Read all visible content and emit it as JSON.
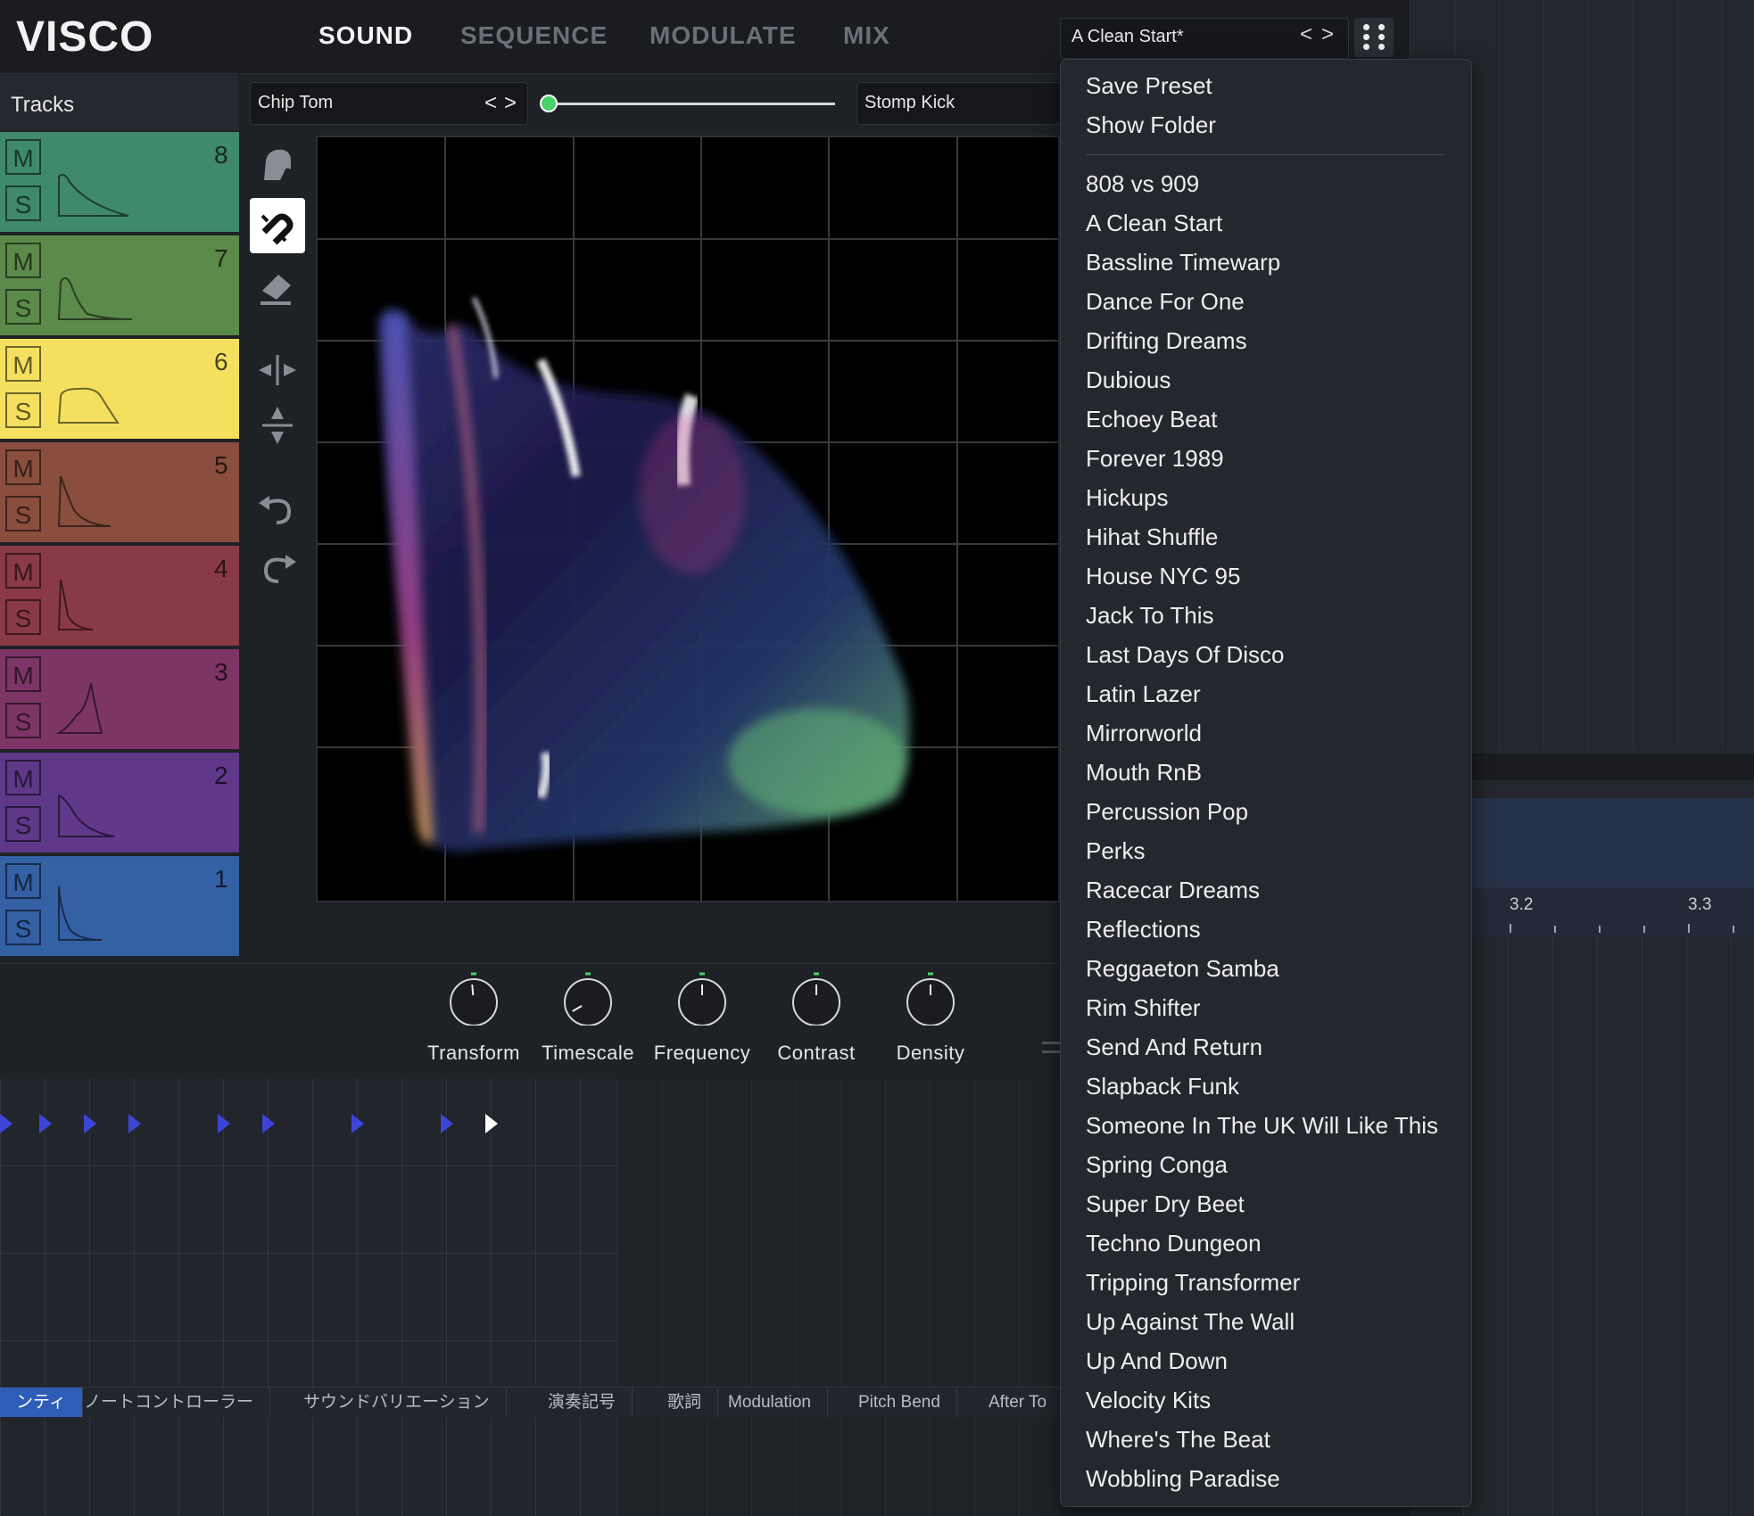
{
  "app": {
    "logo": "VISCO",
    "nav": [
      {
        "label": "SOUND",
        "active": true
      },
      {
        "label": "SEQUENCE",
        "active": false
      },
      {
        "label": "MODULATE",
        "active": false
      },
      {
        "label": "MIX",
        "active": false
      }
    ],
    "preset": {
      "name": "A Clean Start*",
      "prev": "<",
      "next": ">"
    }
  },
  "tracks": {
    "title": "Tracks",
    "mute_label": "M",
    "solo_label": "S",
    "items": [
      {
        "number": "8",
        "color": "#3f8a6a"
      },
      {
        "number": "7",
        "color": "#5b8a4a"
      },
      {
        "number": "6",
        "color": "#f4e05e"
      },
      {
        "number": "5",
        "color": "#8a4e3e"
      },
      {
        "number": "4",
        "color": "#8a3a46"
      },
      {
        "number": "3",
        "color": "#7d3566"
      },
      {
        "number": "2",
        "color": "#60388a"
      },
      {
        "number": "1",
        "color": "#3460a4"
      }
    ]
  },
  "sources": {
    "a": {
      "name": "Chip Tom",
      "prev": "<",
      "next": ">"
    },
    "b": {
      "name": "Stomp Kick"
    },
    "mix": 0.0
  },
  "knobs": [
    {
      "label": "Transform"
    },
    {
      "label": "Timescale"
    },
    {
      "label": "Frequency"
    },
    {
      "label": "Contrast"
    },
    {
      "label": "Density"
    }
  ],
  "piano_roll": {
    "tabs": [
      "ンティ",
      "ノートコントローラー",
      "サウンドバリエーション",
      "演奏記号",
      "歌詞",
      "Modulation",
      "Pitch Bend",
      "After To"
    ]
  },
  "daw": {
    "ruler": [
      "3.2",
      "3.3"
    ]
  },
  "menu": {
    "actions": [
      "Save Preset",
      "Show Folder"
    ],
    "presets": [
      "808 vs 909",
      "A Clean Start",
      "Bassline Timewarp",
      "Dance For One",
      "Drifting Dreams",
      "Dubious",
      "Echoey Beat",
      "Forever 1989",
      "Hickups",
      "Hihat Shuffle",
      "House NYC 95",
      "Jack To This",
      "Last Days Of Disco",
      "Latin Lazer",
      "Mirrorworld",
      "Mouth RnB",
      "Percussion Pop",
      "Perks",
      "Racecar Dreams",
      "Reflections",
      "Reggaeton Samba",
      "Rim Shifter",
      "Send And Return",
      "Slapback Funk",
      "Someone In The UK Will Like This",
      "Spring Conga",
      "Super Dry Beet",
      "Techno Dungeon",
      "Tripping Transformer",
      "Up Against The Wall",
      "Up And Down",
      "Velocity Kits",
      "Where's The Beat",
      "Wobbling Paradise"
    ]
  }
}
